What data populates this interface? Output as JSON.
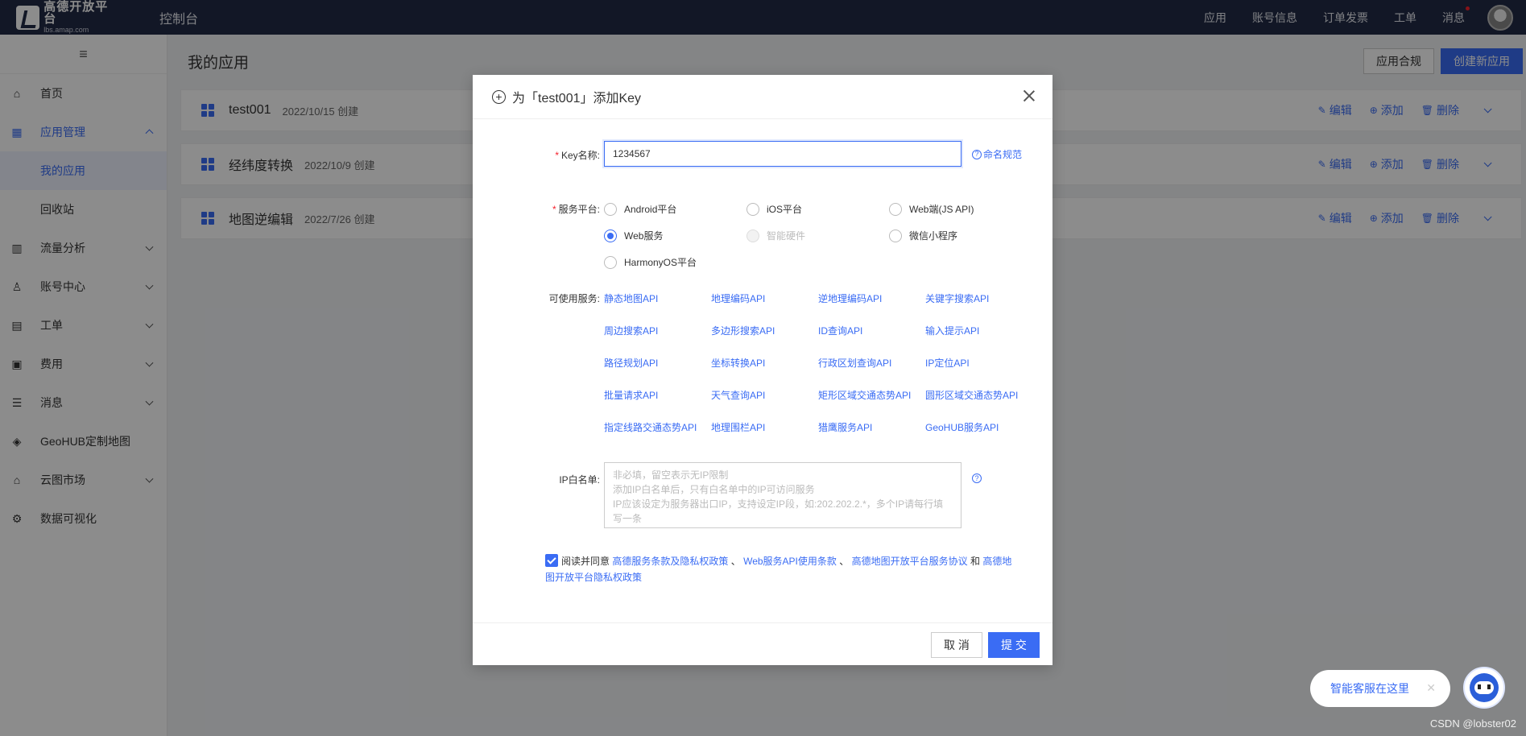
{
  "topbar": {
    "logo_title": "高德开放平台",
    "logo_sub": "lbs.amap.com",
    "console": "控制台",
    "nav": [
      "应用",
      "账号信息",
      "订单发票",
      "工单",
      "消息"
    ]
  },
  "sidebar": {
    "toggle": "≡",
    "items": [
      {
        "label": "首页",
        "icon": "home-icon"
      },
      {
        "label": "应用管理",
        "icon": "apps-icon"
      },
      {
        "label": "我的应用"
      },
      {
        "label": "回收站"
      },
      {
        "label": "流量分析",
        "icon": "chart-icon"
      },
      {
        "label": "账号中心",
        "icon": "user-icon"
      },
      {
        "label": "工单",
        "icon": "ticket-icon"
      },
      {
        "label": "费用",
        "icon": "fee-icon"
      },
      {
        "label": "消息",
        "icon": "message-icon"
      },
      {
        "label": "GeoHUB定制地图",
        "icon": "layers-icon"
      },
      {
        "label": "云图市场",
        "icon": "store-icon"
      },
      {
        "label": "数据可视化",
        "icon": "visual-icon"
      }
    ]
  },
  "main": {
    "title": "我的应用",
    "compliance_button": "应用合规",
    "create_button": "创建新应用",
    "apps": [
      {
        "name": "test001",
        "date": "2022/10/15 创建"
      },
      {
        "name": "经纬度转换",
        "date": "2022/10/9 创建"
      },
      {
        "name": "地图逆编辑",
        "date": "2022/7/26 创建"
      }
    ],
    "actions": {
      "edit": "编辑",
      "add": "添加",
      "delete": "删除"
    }
  },
  "modal": {
    "title": "为「test001」添加Key",
    "key_label": "Key名称:",
    "key_value": "1234567",
    "naming_link": "命名规范",
    "platform_label": "服务平台:",
    "platforms": [
      {
        "label": "Android平台",
        "checked": false,
        "disabled": false
      },
      {
        "label": "iOS平台",
        "checked": false,
        "disabled": false
      },
      {
        "label": "Web端(JS API)",
        "checked": false,
        "disabled": false
      },
      {
        "label": "Web服务",
        "checked": true,
        "disabled": false
      },
      {
        "label": "智能硬件",
        "checked": false,
        "disabled": true
      },
      {
        "label": "微信小程序",
        "checked": false,
        "disabled": false
      },
      {
        "label": "HarmonyOS平台",
        "checked": false,
        "disabled": false
      }
    ],
    "services_label": "可使用服务:",
    "services": [
      "静态地图API",
      "地理编码API",
      "逆地理编码API",
      "关键字搜索API",
      "周边搜索API",
      "多边形搜索API",
      "ID查询API",
      "输入提示API",
      "路径规划API",
      "坐标转换API",
      "行政区划查询API",
      "IP定位API",
      "批量请求API",
      "天气查询API",
      "矩形区域交通态势API",
      "圆形区域交通态势API",
      "指定线路交通态势API",
      "地理围栏API",
      "猎鹰服务API",
      "GeoHUB服务API"
    ],
    "ip_label": "IP白名单:",
    "ip_placeholder": "非必填，留空表示无IP限制\n添加IP白名单后，只有白名单中的IP可访问服务\nIP应该设定为服务器出口IP，支持设定IP段，如:202.202.2.*，多个IP请每行填写一条",
    "agree_prefix": "阅读并同意",
    "agree_link1": "高德服务条款及隐私权政策",
    "agree_sep1": "、",
    "agree_link2": "Web服务API使用条款",
    "agree_sep2": "、",
    "agree_link3": "高德地图开放平台服务协议",
    "agree_and": "和",
    "agree_link4": "高德地图开放平台隐私权政策",
    "cancel": "取 消",
    "submit": "提 交"
  },
  "chat": {
    "label": "智能客服在这里",
    "close": "✕"
  },
  "watermark": "CSDN @lobster02",
  "colors": {
    "accent": "#3a6cf4",
    "topbar": "#222b45"
  }
}
